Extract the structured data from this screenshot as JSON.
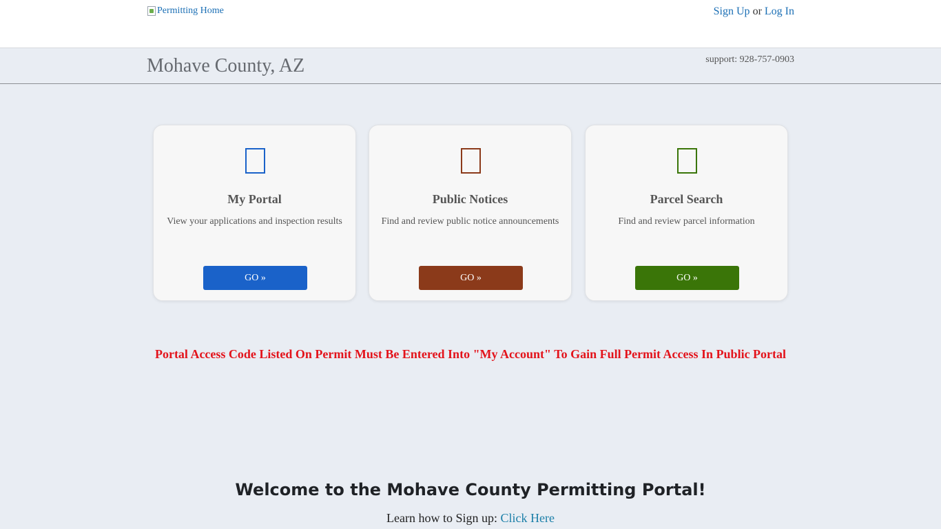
{
  "header": {
    "logo_alt": "Permitting Home",
    "sign_up": "Sign Up",
    "or_text": "or",
    "log_in": "Log In"
  },
  "subheader": {
    "county": "Mohave County, AZ",
    "support": "support: 928-757-0903"
  },
  "cards": [
    {
      "title": "My Portal",
      "description": "View your applications and inspection results",
      "button": "GO »",
      "color": "#1a62c9",
      "icon": "document-icon"
    },
    {
      "title": "Public Notices",
      "description": "Find and review public notice announcements",
      "button": "GO »",
      "color": "#8b3a1a",
      "icon": "document-icon"
    },
    {
      "title": "Parcel Search",
      "description": "Find and review parcel information",
      "button": "GO »",
      "color": "#3a7508",
      "icon": "document-icon"
    }
  ],
  "notice": "Portal Access Code Listed On Permit Must Be Entered Into \"My Account\" To Gain Full Permit Access In Public Portal",
  "welcome": {
    "title": "Welcome to the Mohave County Permitting Portal!",
    "learn_prefix": "Learn how to Sign up:",
    "learn_link": "Click Here"
  }
}
